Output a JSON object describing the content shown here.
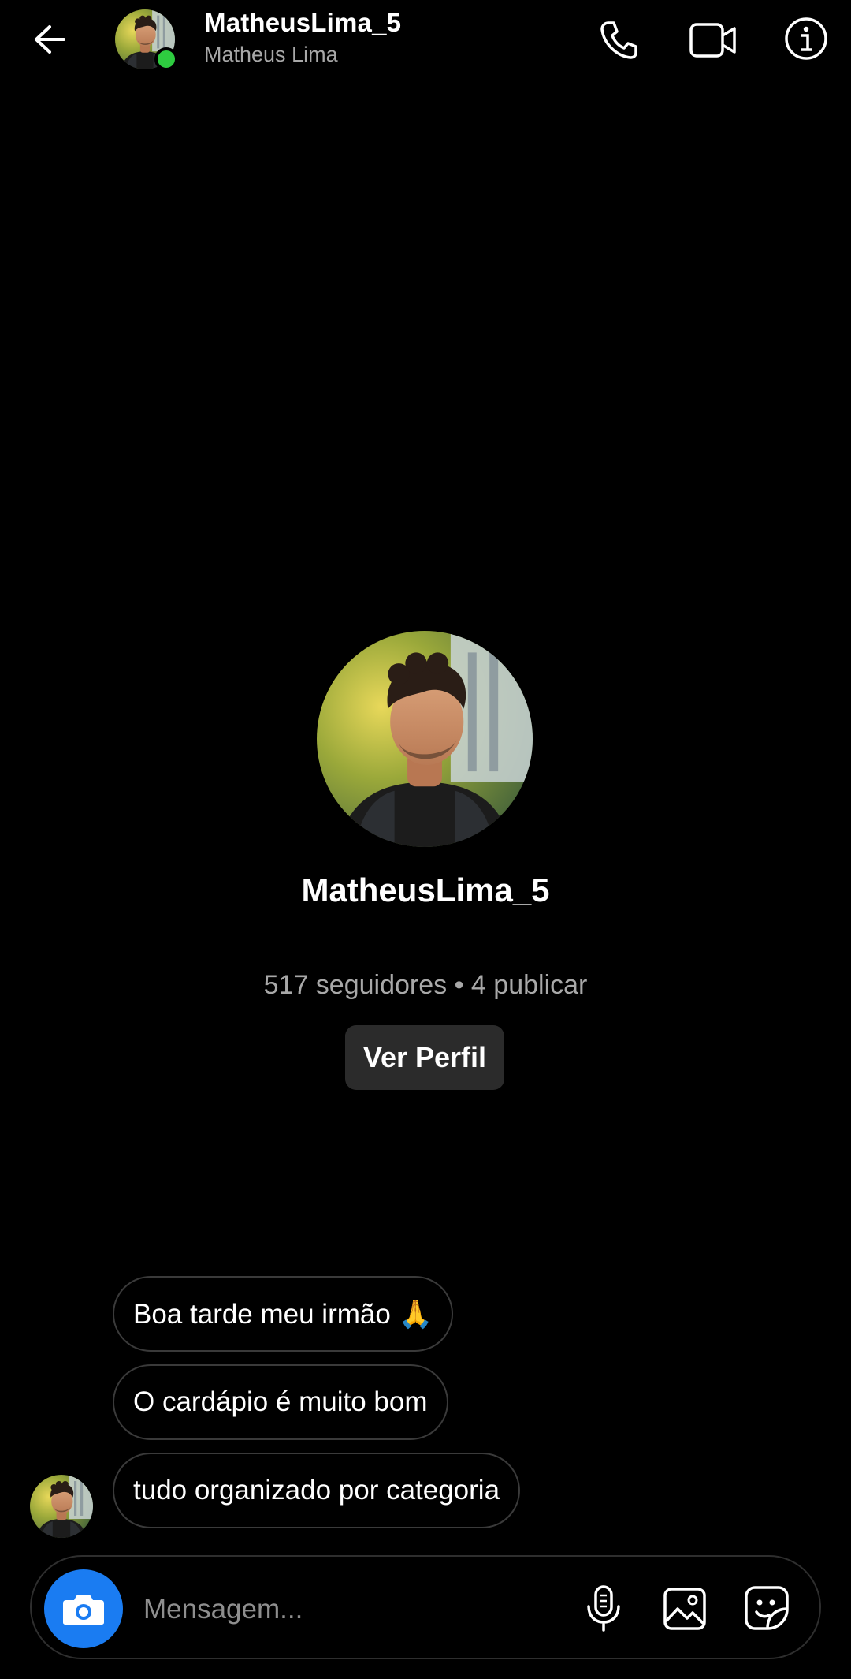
{
  "header": {
    "username": "MatheusLima_5",
    "display_name": "Matheus Lima",
    "online": true,
    "icons": [
      "back-arrow-icon",
      "phone-icon",
      "video-camera-icon",
      "info-icon"
    ]
  },
  "profile": {
    "username": "MatheusLima_5",
    "stats": "517 seguidores • 4 publicar",
    "view_profile_label": "Ver Perfil"
  },
  "messages": [
    {
      "text": "Boa tarde meu irmão 🙏"
    },
    {
      "text": "O cardápio é muito bom"
    },
    {
      "text": "tudo organizado por categoria"
    }
  ],
  "composer": {
    "placeholder": "Mensagem...",
    "icons": [
      "camera-icon",
      "microphone-icon",
      "gallery-icon",
      "sticker-icon"
    ]
  },
  "colors": {
    "background": "#000000",
    "accent": "#1a7cf2",
    "online": "#2ecc40",
    "bubble_border": "#3a3a3a",
    "secondary_text": "#a8a8a8",
    "button_bg": "#2b2b2b"
  }
}
